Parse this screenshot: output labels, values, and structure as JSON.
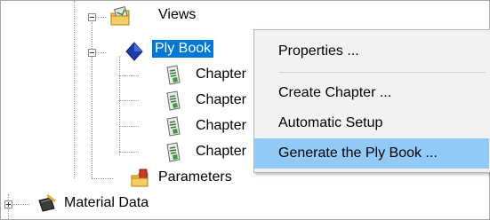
{
  "tree": {
    "views_label": "Views",
    "ply_book_label": "Ply Book",
    "chapters": [
      {
        "label": "Chapter"
      },
      {
        "label": "Chapter"
      },
      {
        "label": "Chapter"
      },
      {
        "label": "Chapter"
      }
    ],
    "parameters_label": "Parameters",
    "material_data_label": "Material Data",
    "selection_color": "#0078d7"
  },
  "context_menu": {
    "items": [
      {
        "label": "Properties ..."
      },
      {
        "label": "Create Chapter ..."
      },
      {
        "label": "Automatic Setup"
      },
      {
        "label": "Generate the Ply Book ..."
      }
    ],
    "hover_color": "#91c9f7"
  }
}
